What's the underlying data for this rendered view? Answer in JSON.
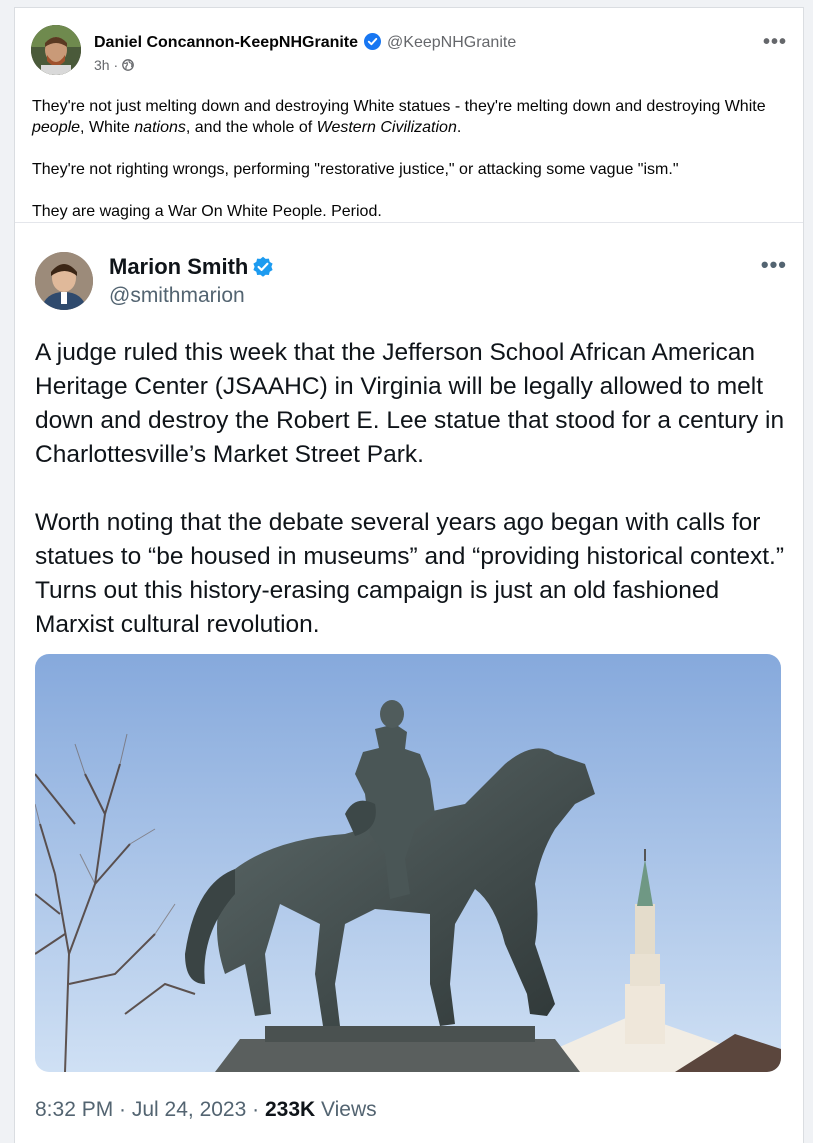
{
  "post": {
    "author": "Daniel Concannon-KeepNHGranite",
    "handle": "@KeepNHGranite",
    "time": "3h",
    "separator": "·",
    "more": "•••",
    "p1_a": "They're not just melting down and destroying White statues - they're melting down and destroying White ",
    "p1_em1": "people",
    "p1_b": ", White ",
    "p1_em2": "nations",
    "p1_c": ", and the whole of ",
    "p1_em3": "Western Civilization",
    "p1_d": ".",
    "p2": "They're not righting wrongs, performing \"restorative justice,\" or attacking some vague \"ism.\"",
    "p3": "They are waging a War On White People. Period."
  },
  "tweet": {
    "name": "Marion Smith",
    "handle": "@smithmarion",
    "more": "•••",
    "p1": "A judge ruled this week that the Jefferson School African American Heritage Center (JSAAHC) in Virginia will be legally allowed to melt down and destroy the Robert E. Lee statue that stood for a century in Charlottesville’s Market Street Park.",
    "p2": "Worth noting that the debate several years ago began with calls for statues to “be housed in museums” and “providing historical context.” Turns out this history-erasing campaign is just an old fashioned Marxist cultural revolution.",
    "time": "8:32 PM · Jul 24, 2023 · ",
    "views_count": "233K",
    "views_label": " Views"
  },
  "colors": {
    "verified": "#1d9bf0",
    "fb_verified": "#1877f2",
    "sky_top": "#8fb1e0",
    "sky_bottom": "#c9dcf2"
  },
  "icons": {
    "globe": "globe-icon",
    "verified": "verified-badge-icon",
    "more": "more-dots-icon"
  }
}
